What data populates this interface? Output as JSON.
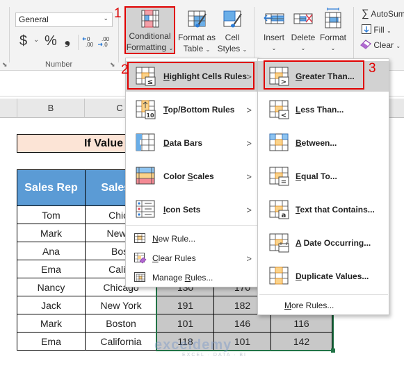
{
  "ribbon": {
    "number_format": {
      "value": "General"
    },
    "number_group": {
      "label": "Number",
      "currency": "$",
      "currency_chevron": "⌄",
      "percent": "%",
      "comma": "❟",
      "increase_decimal": ".00",
      "decrease_decimal": ".0"
    },
    "conditional_formatting": {
      "line1": "Conditional",
      "line2": "Formatting",
      "chevron": "⌄"
    },
    "format_as_table": {
      "line1": "Format as",
      "line2": "Table",
      "chevron": "⌄"
    },
    "cell_styles": {
      "line1": "Cell",
      "line2": "Styles",
      "chevron": "⌄"
    },
    "insert": {
      "label": "Insert",
      "chevron": "⌄"
    },
    "delete": {
      "label": "Delete",
      "chevron": "⌄"
    },
    "format": {
      "label": "Format",
      "chevron": "⌄"
    },
    "autosum": {
      "label": "AutoSum"
    },
    "fill": {
      "label": "Fill",
      "chevron": "⌄"
    },
    "clear": {
      "label": "Clear",
      "chevron": "⌄"
    }
  },
  "annotations": {
    "step1": "1",
    "step2": "2",
    "step3": "3"
  },
  "sheet": {
    "columns": [
      "B",
      "C"
    ],
    "title": "If Value",
    "headers": [
      "Sales Rep",
      "Sales A"
    ],
    "rows": [
      {
        "rep": "Tom",
        "region": "Chica",
        "v1": "",
        "v2": "",
        "v3": ""
      },
      {
        "rep": "Mark",
        "region": "New Y",
        "v1": "",
        "v2": "",
        "v3": ""
      },
      {
        "rep": "Ana",
        "region": "Bost",
        "v1": "",
        "v2": "",
        "v3": ""
      },
      {
        "rep": "Ema",
        "region": "Califo",
        "v1": "",
        "v2": "",
        "v3": ""
      },
      {
        "rep": "Nancy",
        "region": "Chicago",
        "v1": "130",
        "v2": "170",
        "v3": ""
      },
      {
        "rep": "Jack",
        "region": "New York",
        "v1": "191",
        "v2": "182",
        "v3": ""
      },
      {
        "rep": "Mark",
        "region": "Boston",
        "v1": "101",
        "v2": "146",
        "v3": "116"
      },
      {
        "rep": "Ema",
        "region": "California",
        "v1": "118",
        "v2": "101",
        "v3": "142"
      }
    ],
    "watermark": "exceldemy",
    "watermark_sub": "EXCEL · DATA · BI"
  },
  "cf_menu": {
    "items": [
      {
        "label": "Highlight Cells Rules",
        "accel": "H",
        "rest": "ighlight Cells Rules",
        "icon": "highlight-cells-icon",
        "submenu": true
      },
      {
        "label": "Top/Bottom Rules",
        "accel": "T",
        "rest": "op/Bottom Rules",
        "icon": "top-bottom-icon",
        "submenu": true
      },
      {
        "label": "Data Bars",
        "accel": "D",
        "rest": "ata Bars",
        "icon": "data-bars-icon",
        "submenu": true
      },
      {
        "label": "Color Scales",
        "pre": "Color ",
        "accel": "S",
        "rest": "cales",
        "icon": "color-scales-icon",
        "submenu": true
      },
      {
        "label": "Icon Sets",
        "accel": "I",
        "rest": "con Sets",
        "icon": "icon-sets-icon",
        "submenu": true
      }
    ],
    "small_items": [
      {
        "label": "New Rule...",
        "accel": "N",
        "rest": "ew Rule...",
        "submenu": false
      },
      {
        "label": "Clear Rules",
        "accel": "C",
        "rest": "lear Rules",
        "submenu": true
      },
      {
        "label": "Manage Rules...",
        "pre": "Manage ",
        "accel": "R",
        "rest": "ules...",
        "submenu": false
      }
    ],
    "arrow": ">"
  },
  "highlight_submenu": {
    "items": [
      {
        "label": "Greater Than...",
        "accel": "G",
        "rest": "reater Than...",
        "glyph": ">"
      },
      {
        "label": "Less Than...",
        "accel": "L",
        "rest": "ess Than...",
        "glyph": "<"
      },
      {
        "label": "Between...",
        "accel": "B",
        "rest": "etween...",
        "glyph": ""
      },
      {
        "label": "Equal To...",
        "accel": "E",
        "rest": "qual To...",
        "glyph": "="
      },
      {
        "label": "Text that Contains...",
        "accel": "T",
        "rest": "ext that Contains...",
        "glyph": "a"
      },
      {
        "label": "A Date Occurring...",
        "accel": "A",
        "rest": " Date Occurring...",
        "glyph": ""
      },
      {
        "label": "Duplicate Values...",
        "accel": "D",
        "rest": "uplicate Values...",
        "glyph": ""
      }
    ],
    "more_rules": {
      "accel": "M",
      "rest": "ore Rules..."
    }
  },
  "colors": {
    "accent_red": "#e00000",
    "header_blue": "#5b9bd5",
    "title_fill": "#fce4d6",
    "selection_green": "#217346"
  }
}
